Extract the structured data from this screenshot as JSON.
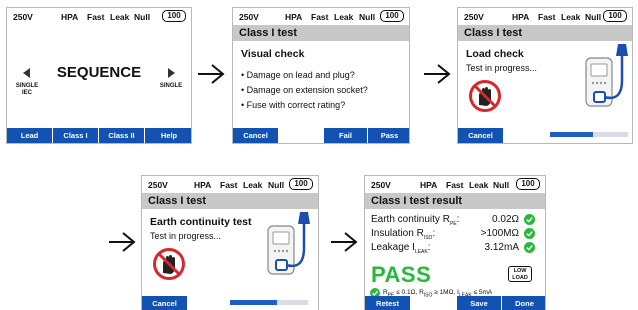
{
  "status": {
    "voltage": "250V",
    "hpa": "HPA",
    "fast": "Fast",
    "leak": "Leak",
    "null": "Null",
    "battery": "100"
  },
  "screen1": {
    "title": "SEQUENCE",
    "left_label_1": "SINGLE",
    "left_label_2": "IEC",
    "right_label": "SINGLE",
    "buttons": [
      "Lead",
      "Class I",
      "Class II",
      "Help"
    ]
  },
  "screen2": {
    "title": "Class I test",
    "heading": "Visual check",
    "items": [
      "Damage on lead and plug?",
      "Damage on extension socket?",
      "Fuse with correct rating?"
    ],
    "buttons": {
      "cancel": "Cancel",
      "fail": "Fail",
      "pass": "Pass"
    }
  },
  "screen3": {
    "title": "Class I test",
    "heading": "Load check",
    "text": "Test in progress...",
    "cancel": "Cancel",
    "progress": 0.55
  },
  "screen4": {
    "title": "Class I test",
    "heading": "Earth continuity test",
    "text": "Test in progress...",
    "cancel": "Cancel",
    "progress": 0.6
  },
  "screen5": {
    "title": "Class I test result",
    "rows": [
      {
        "label": "Earth continuity R",
        "sub": "PE",
        "suffix": ":",
        "value": "0.02Ω"
      },
      {
        "label": "Insulation R",
        "sub": "ISO",
        "suffix": ":",
        "value": ">100MΩ"
      },
      {
        "label": "Leakage I",
        "sub": "LEAK",
        "suffix": ":",
        "value": "3.12mA"
      }
    ],
    "result": "PASS",
    "low_load_1": "LOW",
    "low_load_2": "LOAD",
    "limit_r": "R",
    "limit_r_sub": "PE",
    "limit_r_val": " ≤ 0.1Ω, ",
    "limit_iso": "R",
    "limit_iso_sub": "ISO",
    "limit_iso_val": " ≥ 1MΩ, ",
    "limit_i": "I",
    "limit_i_sub": "LEAK",
    "limit_i_val": "  ≤ 5mA",
    "buttons": {
      "retest": "Retest",
      "save": "Save",
      "done": "Done"
    }
  },
  "colors": {
    "button_blue": "#1252b3",
    "pass_green": "#28b83c",
    "stop_red": "#d9262b",
    "title_gray": "#c8c8c8"
  }
}
